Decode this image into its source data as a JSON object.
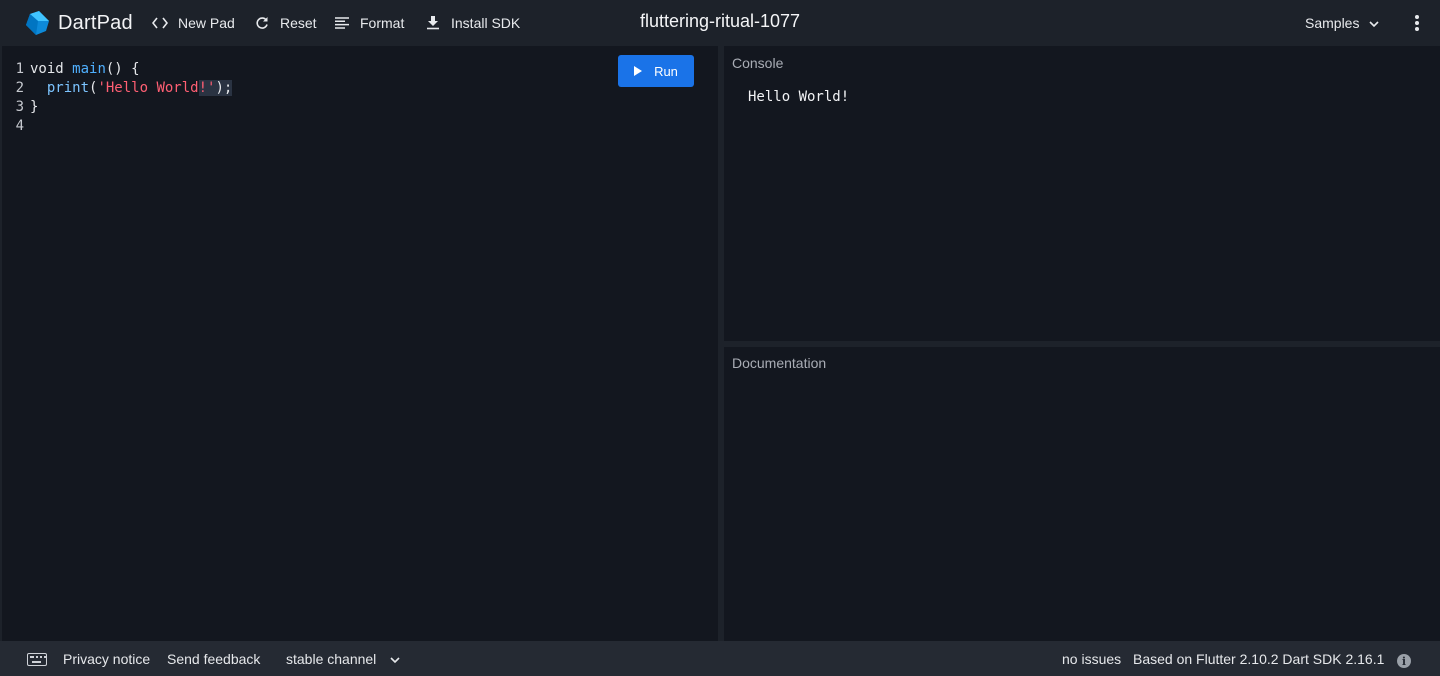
{
  "header": {
    "app_name": "DartPad",
    "toolbar": {
      "new_pad": "New Pad",
      "reset": "Reset",
      "format": "Format",
      "install_sdk": "Install SDK"
    },
    "pad_title": "fluttering-ritual-1077",
    "samples_label": "Samples"
  },
  "editor": {
    "line_numbers": [
      "1",
      "2",
      "3",
      "4"
    ],
    "code": {
      "l1_void": "void",
      "l1_main": "main",
      "l1_rest": "() {",
      "l2_indent": "  ",
      "l2_print": "print",
      "l2_paren": "(",
      "l2_str": "'Hello World",
      "l2_sel_str": "!'",
      "l2_sel_end": ");",
      "l3": "}"
    },
    "run_label": "Run"
  },
  "console": {
    "label": "Console",
    "output": "Hello World!"
  },
  "documentation": {
    "label": "Documentation"
  },
  "footer": {
    "privacy_notice": "Privacy notice",
    "send_feedback": "Send feedback",
    "channel": "stable channel",
    "issues": "no issues",
    "version": "Based on Flutter 2.10.2 Dart SDK 2.16.1"
  },
  "colors": {
    "accent": "#1a73e8",
    "string": "#ff5f73",
    "function": "#4fb0ff",
    "background": "#13171f",
    "header": "#1d222a",
    "footer": "#252a33"
  },
  "icons": [
    "dart-logo-icon",
    "code-brackets-icon",
    "refresh-icon",
    "format-align-icon",
    "download-icon",
    "chevron-down-icon",
    "more-vert-icon",
    "play-icon",
    "keyboard-icon",
    "info-icon"
  ]
}
